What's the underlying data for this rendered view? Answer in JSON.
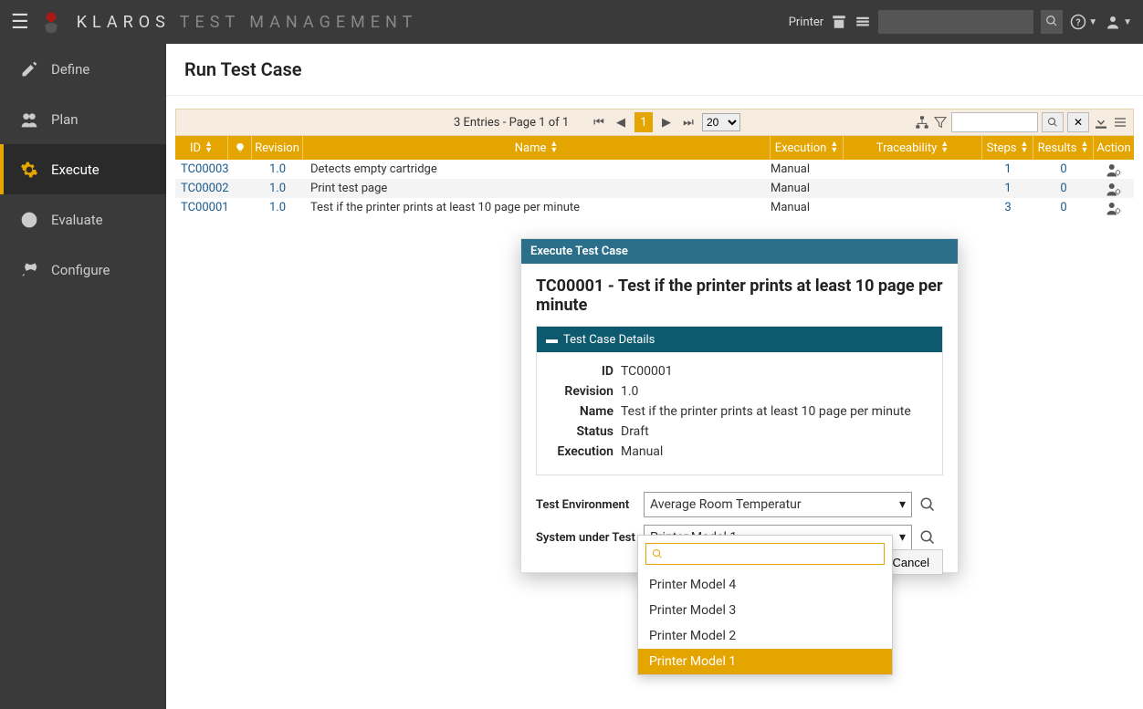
{
  "app": {
    "brand": "KLAROS",
    "brand_sub": "TEST MANAGEMENT"
  },
  "topbar": {
    "printer_label": "Printer"
  },
  "sidebar": {
    "items": [
      {
        "label": "Define"
      },
      {
        "label": "Plan"
      },
      {
        "label": "Execute"
      },
      {
        "label": "Evaluate"
      },
      {
        "label": "Configure"
      }
    ]
  },
  "page": {
    "title": "Run Test Case"
  },
  "pager": {
    "text": "3 Entries - Page 1 of 1",
    "page": "1",
    "page_size": "20"
  },
  "table": {
    "headers": {
      "id": "ID",
      "revision": "Revision",
      "name": "Name",
      "execution": "Execution",
      "traceability": "Traceability",
      "steps": "Steps",
      "results": "Results",
      "action": "Action"
    },
    "rows": [
      {
        "id": "TC00003",
        "revision": "1.0",
        "name": "Detects empty cartridge",
        "execution": "Manual",
        "steps": "1",
        "results": "0"
      },
      {
        "id": "TC00002",
        "revision": "1.0",
        "name": "Print test page",
        "execution": "Manual",
        "steps": "1",
        "results": "0"
      },
      {
        "id": "TC00001",
        "revision": "1.0",
        "name": "Test if the printer prints at least 10 page per minute",
        "execution": "Manual",
        "steps": "3",
        "results": "0"
      }
    ]
  },
  "modal": {
    "header": "Execute Test Case",
    "title": "TC00001 - Test if the printer prints at least 10 page per minute",
    "details_header": "Test Case Details",
    "details": {
      "id_label": "ID",
      "id": "TC00001",
      "revision_label": "Revision",
      "revision": "1.0",
      "name_label": "Name",
      "name": "Test if the printer prints at least 10 page per minute",
      "status_label": "Status",
      "status": "Draft",
      "execution_label": "Execution",
      "execution": "Manual"
    },
    "form": {
      "env_label": "Test Environment",
      "env_value": "Average Room Temperatur",
      "sut_label": "System under Test",
      "sut_value": "Printer Model 1",
      "cancel": "Cancel"
    }
  },
  "dropdown": {
    "items": [
      "Printer Model 4",
      "Printer Model 3",
      "Printer Model 2",
      "Printer Model 1"
    ],
    "selected": "Printer Model 1"
  }
}
